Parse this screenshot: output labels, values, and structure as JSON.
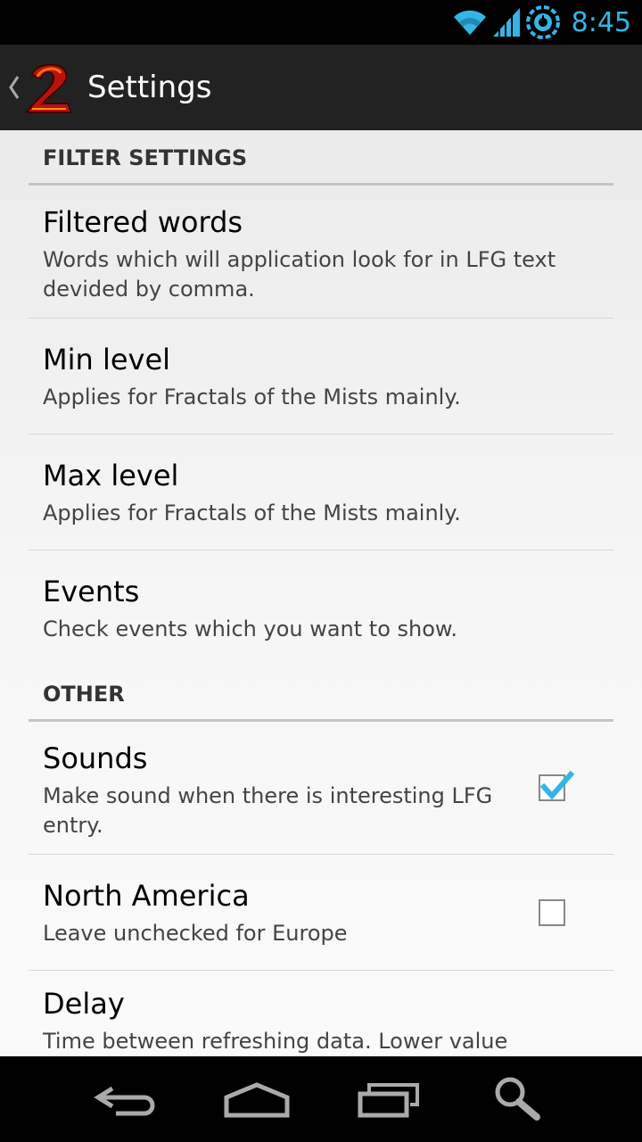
{
  "status_bar": {
    "time": "8:45",
    "icons": [
      "wifi-icon",
      "signal-icon",
      "sync-icon"
    ],
    "accent_color": "#33b5e5"
  },
  "action_bar": {
    "title": "Settings",
    "icons": [
      "back-chevron-icon",
      "app-logo-icon"
    ]
  },
  "sections": {
    "filter": {
      "header": "FILTER SETTINGS",
      "filtered_words": {
        "title": "Filtered words",
        "summary": "Words which will application look for in LFG text devided by comma."
      },
      "min_level": {
        "title": "Min level",
        "summary": "Applies for Fractals of the Mists mainly."
      },
      "max_level": {
        "title": "Max level",
        "summary": "Applies for Fractals of the Mists mainly."
      },
      "events": {
        "title": "Events",
        "summary": "Check events which you want to show."
      }
    },
    "other": {
      "header": "OTHER",
      "sounds": {
        "title": "Sounds",
        "summary": "Make sound when there is interesting LFG entry.",
        "checked": true
      },
      "north_america": {
        "title": "North America",
        "summary": "Leave unchecked for Europe",
        "checked": false
      },
      "delay": {
        "title": "Delay",
        "summary": "Time between refreshing data. Lower value"
      }
    }
  },
  "nav_bar": {
    "icons": [
      "back-icon",
      "home-icon",
      "recent-apps-icon",
      "search-icon"
    ]
  }
}
